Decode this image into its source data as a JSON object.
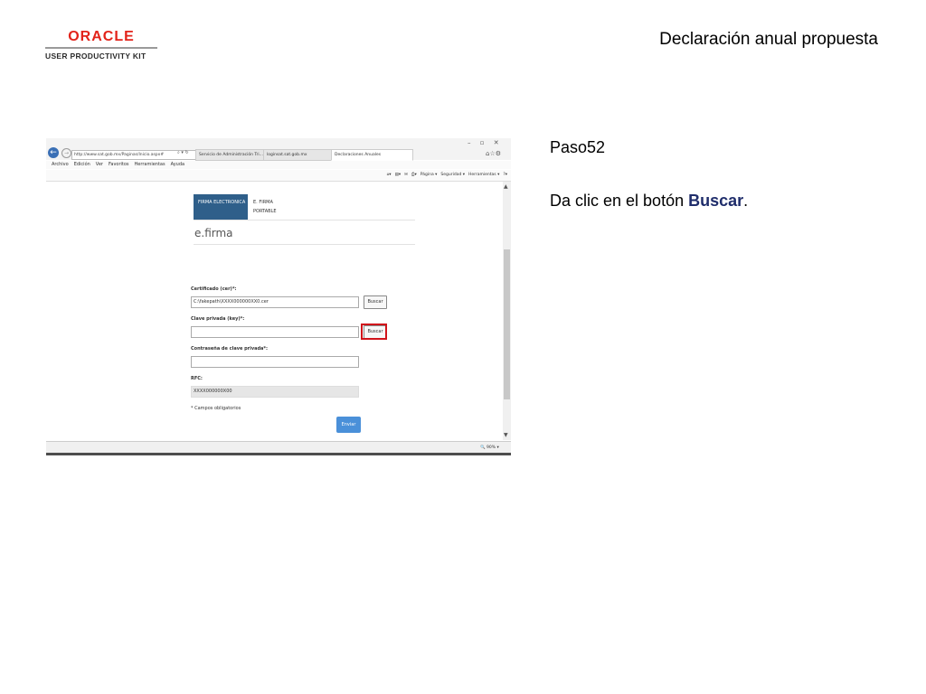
{
  "header": {
    "logo_word": "ORACLE",
    "logo_sub": "USER PRODUCTIVITY KIT",
    "title": "Declaración anual propuesta"
  },
  "step": {
    "label": "Paso52",
    "instruction_prefix": "Da clic en el botón ",
    "instruction_bold": "Buscar",
    "instruction_suffix": "."
  },
  "browser": {
    "address": "http://www.sat.gob.mx/Paginas/Inicio.aspx#",
    "tabs": [
      {
        "label": "Servicio de Administración Tri..."
      },
      {
        "label": "loginsat.sat.gob.mx"
      },
      {
        "label": "Declaraciones Anuales"
      }
    ],
    "menu": [
      "Archivo",
      "Edición",
      "Ver",
      "Favoritos",
      "Herramientas",
      "Ayuda"
    ],
    "commands": [
      "Página ▾",
      "Seguridad ▾",
      "Herramientas ▾"
    ],
    "zoom": "90%"
  },
  "form": {
    "tab_firma": "FIRMA ELECTRONICA",
    "tab_portable": "E. FIRMA PORTABLE",
    "title": "e.firma",
    "cert_label": "Certificado (cer)*:",
    "cert_value": "C:\\fakepath\\XXXX000000XX0.cer",
    "buscar1": "Buscar",
    "key_label": "Clave privada (key)*:",
    "key_value": "",
    "buscar2": "Buscar",
    "pwd_label": "Contraseña de clave privada*:",
    "pwd_value": "",
    "rfc_label": "RFC:",
    "rfc_value": "XXXX000000X00",
    "required_note": "* Campos obligatorios",
    "enviar": "Enviar"
  },
  "colors": {
    "oracle_red": "#e2231a",
    "highlight": "#d0141b",
    "firma_blue": "#2f5f8a",
    "enviar_blue": "#4a90d9",
    "bold_text": "#1f2d6b"
  }
}
